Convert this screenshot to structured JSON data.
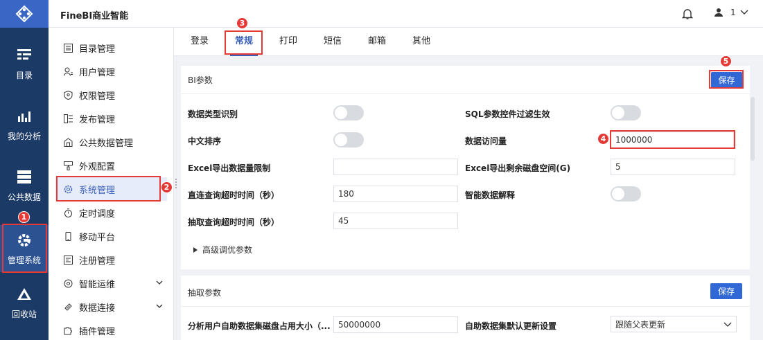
{
  "app": {
    "title": "FineBI商业智能"
  },
  "user": {
    "name": "1"
  },
  "rail": [
    {
      "label": "目录",
      "icon": "catalog-icon"
    },
    {
      "label": "我的分析",
      "icon": "analysis-chart-icon"
    },
    {
      "label": "公共数据",
      "icon": "public-data-icon"
    },
    {
      "label": "管理系统",
      "icon": "admin-gear-icon"
    },
    {
      "label": "回收站",
      "icon": "recycle-icon"
    }
  ],
  "menu": [
    {
      "label": "目录管理"
    },
    {
      "label": "用户管理"
    },
    {
      "label": "权限管理"
    },
    {
      "label": "发布管理"
    },
    {
      "label": "公共数据管理"
    },
    {
      "label": "外观配置"
    },
    {
      "label": "系统管理"
    },
    {
      "label": "定时调度"
    },
    {
      "label": "移动平台"
    },
    {
      "label": "注册管理"
    },
    {
      "label": "智能运维"
    },
    {
      "label": "数据连接"
    },
    {
      "label": "插件管理"
    }
  ],
  "tabs": [
    {
      "label": "登录"
    },
    {
      "label": "常规"
    },
    {
      "label": "打印"
    },
    {
      "label": "短信"
    },
    {
      "label": "邮箱"
    },
    {
      "label": "其他"
    }
  ],
  "bi": {
    "title": "BI参数",
    "save": "保存",
    "type_detect": "数据类型识别",
    "sql_filter": "SQL参数控件过滤生效",
    "cn_sort": "中文排序",
    "data_access": "数据访问量",
    "data_access_value": "1000000",
    "excel_limit": "Excel导出数据量限制",
    "excel_limit_value": "",
    "excel_disk": "Excel导出剩余磁盘空间(G)",
    "excel_disk_value": "5",
    "direct_timeout": "直连查询超时时间（秒）",
    "direct_timeout_value": "180",
    "smart_explain": "智能数据解释",
    "extract_timeout": "抽取查询超时时间（秒）",
    "extract_timeout_value": "45",
    "advanced": "高级调优参数"
  },
  "extract": {
    "title": "抽取参数",
    "save": "保存",
    "disk_usage": "分析用户自助数据集磁盘占用大小（...",
    "disk_usage_value": "50000000",
    "default_update": "自助数据集默认更新设置",
    "default_update_value": "跟随父表更新"
  },
  "badges": [
    "1",
    "2",
    "3",
    "4",
    "5"
  ],
  "colors": {
    "accent": "#3168d6",
    "rail": "#1c3a66",
    "annotation": "#e53935"
  }
}
